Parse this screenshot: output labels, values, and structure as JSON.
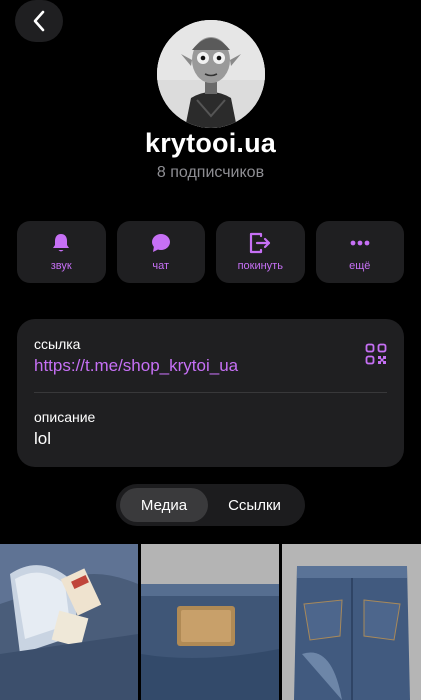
{
  "header": {
    "channel_name": "krytooi.ua",
    "subscribers": "8 подписчиков"
  },
  "actions": [
    {
      "label": "звук",
      "icon": "bell-icon"
    },
    {
      "label": "чат",
      "icon": "chat-bubble-icon"
    },
    {
      "label": "покинуть",
      "icon": "leave-icon"
    },
    {
      "label": "ещё",
      "icon": "more-dots-icon"
    }
  ],
  "info": {
    "link_caption": "ссылка",
    "link": "https://t.me/shop_krytoi_ua",
    "description_caption": "описание",
    "description": "lol"
  },
  "tabs": {
    "media": "Медиа",
    "links": "Ссылки",
    "selected": "Медиа"
  },
  "colors": {
    "accent": "#c670f5",
    "surface": "#1f1f21",
    "background": "#000000"
  }
}
